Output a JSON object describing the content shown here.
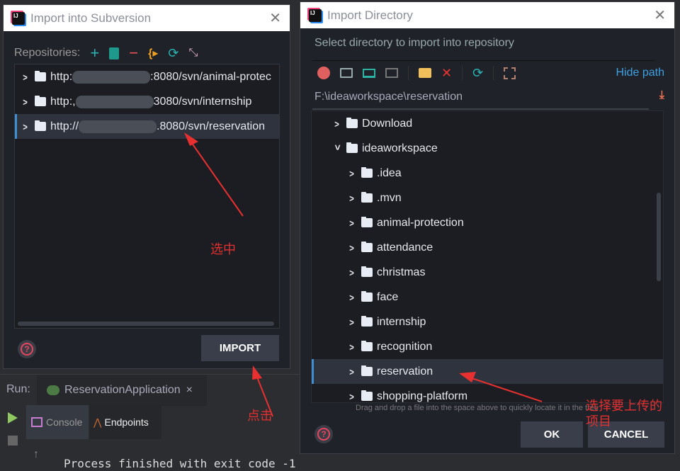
{
  "left_dialog": {
    "title": "Import into Subversion",
    "repositories_label": "Repositories:",
    "repos": [
      {
        "prefix": "http:",
        "suffix": ":8080/svn/animal-protec"
      },
      {
        "prefix": "http:,",
        "suffix": "3080/svn/internship"
      },
      {
        "prefix": "http://",
        "suffix": ".8080/svn/reservation",
        "selected": true
      }
    ],
    "import_label": "IMPORT"
  },
  "right_dialog": {
    "title": "Import Directory",
    "subtitle": "Select directory to import into repository",
    "hide_path": "Hide path",
    "path": "F:\\ideaworkspace\\reservation",
    "tree": [
      {
        "label": "Download",
        "level": 1
      },
      {
        "label": "ideaworkspace",
        "level": 1,
        "expanded": true
      },
      {
        "label": ".idea",
        "level": 2
      },
      {
        "label": ".mvn",
        "level": 2
      },
      {
        "label": "animal-protection",
        "level": 2
      },
      {
        "label": "attendance",
        "level": 2
      },
      {
        "label": "christmas",
        "level": 2
      },
      {
        "label": "face",
        "level": 2
      },
      {
        "label": "internship",
        "level": 2
      },
      {
        "label": "recognition",
        "level": 2
      },
      {
        "label": "reservation",
        "level": 2,
        "selected": true
      },
      {
        "label": "shopping-platform",
        "level": 2
      }
    ],
    "hint": "Drag and drop a file into the space above to quickly locate it in the tree",
    "ok_label": "OK",
    "cancel_label": "CANCEL"
  },
  "run_panel": {
    "run_label": "Run:",
    "tab": "ReservationApplication",
    "console": "Console",
    "endpoints": "Endpoints",
    "output": "Process finished with exit code -1"
  },
  "annotations": {
    "select": "选中",
    "click": "点击",
    "choose_project": "选择要上传的项目"
  },
  "colors": {
    "accent": "#3d8fd1",
    "annotation": "#e03030",
    "dialog_bg": "#1f2229"
  }
}
